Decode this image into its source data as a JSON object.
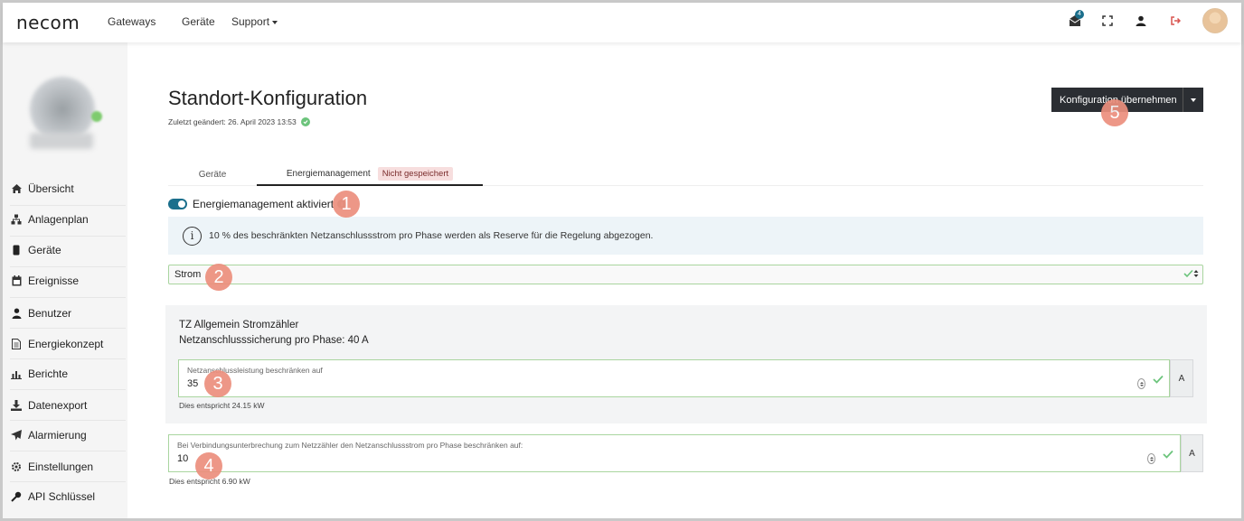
{
  "header": {
    "logo_text": "necom",
    "nav": {
      "gateways": "Gateways",
      "geraete": "Geräte",
      "support": "Support"
    },
    "notification_count": "4"
  },
  "sidebar": {
    "items": [
      {
        "label": "Übersicht",
        "icon": "home-icon"
      },
      {
        "label": "Anlagenplan",
        "icon": "sitemap-icon"
      },
      {
        "label": "Geräte",
        "icon": "device-icon"
      },
      {
        "label": "Ereignisse",
        "icon": "calendar-icon"
      },
      {
        "label": "Benutzer",
        "icon": "user-icon"
      },
      {
        "label": "Energiekonzept",
        "icon": "document-icon"
      },
      {
        "label": "Berichte",
        "icon": "bar-chart-icon"
      },
      {
        "label": "Datenexport",
        "icon": "download-icon"
      },
      {
        "label": "Alarmierung",
        "icon": "paper-plane-icon"
      },
      {
        "label": "Einstellungen",
        "icon": "gear-icon"
      },
      {
        "label": "API Schlüssel",
        "icon": "key-icon"
      }
    ]
  },
  "page": {
    "title": "Standort-Konfiguration",
    "last_changed": "Zuletzt geändert: 26. April 2023 13:53",
    "apply_button": "Konfiguration übernehmen"
  },
  "tabs": {
    "geraete": "Geräte",
    "energie": "Energiemanagement",
    "unsaved_badge": "Nicht gespeichert"
  },
  "energy": {
    "toggle_label": "Energiemanagement aktiviert",
    "info_text": "10 % des beschränkten Netzanschlussstrom pro Phase werden als Reserve für die Regelung abgezogen.",
    "select_value": "Strom"
  },
  "meter": {
    "name": "TZ Allgemein Stromzähler",
    "fuse": "Netzanschlusssicherung pro Phase: 40 A",
    "limit_label": "Netzanschlussleistung beschränken auf",
    "limit_value": "35",
    "limit_unit": "A",
    "limit_hint": "Dies entspricht 24.15 kW"
  },
  "fallback": {
    "label": "Bei Verbindungsunterbrechung zum Netzzähler den Netzanschlussstrom pro Phase beschränken auf:",
    "value": "10",
    "unit": "A",
    "hint": "Dies entspricht 6.90 kW"
  },
  "callouts": [
    "1",
    "2",
    "3",
    "4",
    "5"
  ],
  "colors": {
    "accent": "#1b6f8c",
    "apply_button_bg": "#2b2e33",
    "valid_border": "#a9d59f",
    "callout": "#ec8f7d",
    "unsaved_bg": "#f7dede"
  }
}
